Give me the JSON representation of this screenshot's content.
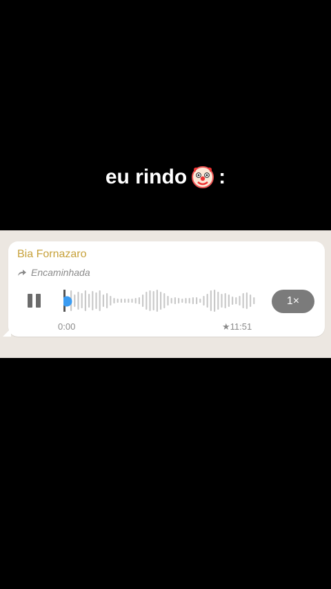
{
  "caption": {
    "text": "eu rindo",
    "emoji_icon": "clown-face-icon",
    "suffix": ":"
  },
  "message": {
    "sender": "Bia Fornazaro",
    "forwarded_label": "Encaminhada",
    "playback": {
      "state": "playing",
      "elapsed": "0:00",
      "duration": "★11:51",
      "speed": "1×"
    }
  },
  "colors": {
    "sender": "#c7a13a",
    "progress_dot": "#3b9cf2",
    "wave": "#c9c9c9",
    "speed_pill": "#7b7b7b"
  }
}
